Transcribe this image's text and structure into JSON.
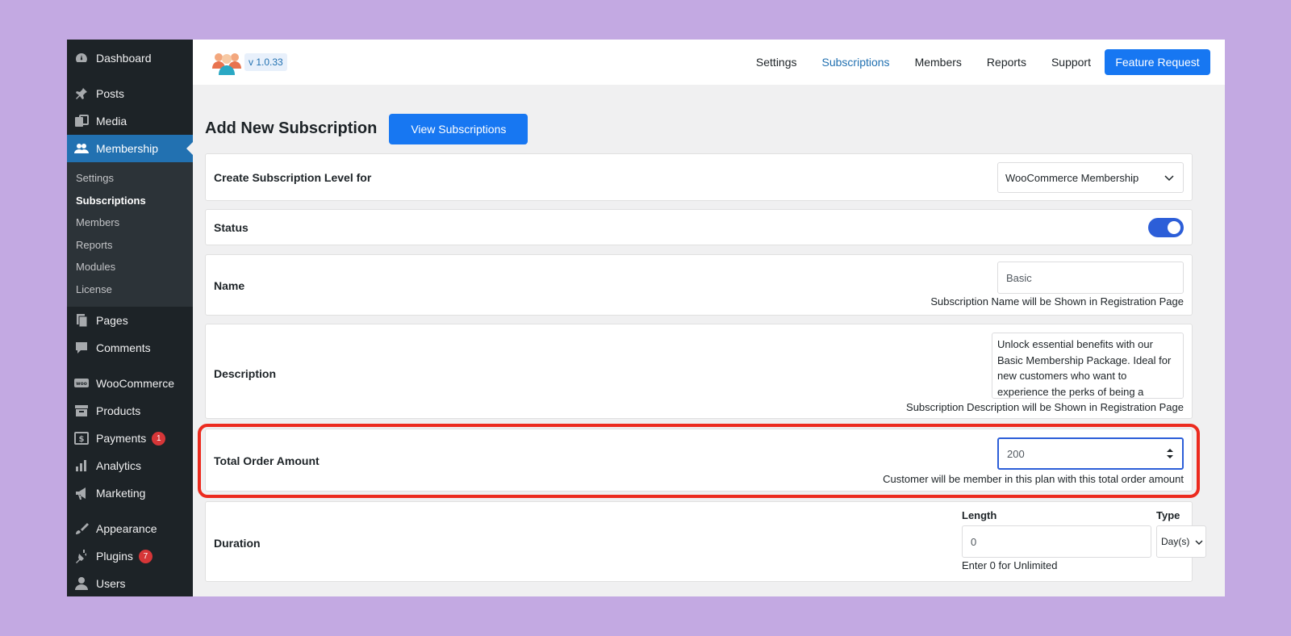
{
  "sidebar": {
    "items": [
      {
        "label": "Dashboard",
        "icon": "dashboard-icon"
      },
      {
        "label": "Posts",
        "icon": "pin-icon"
      },
      {
        "label": "Media",
        "icon": "media-icon"
      },
      {
        "label": "Membership",
        "icon": "users-icon"
      }
    ],
    "submenu": [
      "Settings",
      "Subscriptions",
      "Members",
      "Reports",
      "Modules",
      "License"
    ],
    "items2": [
      {
        "label": "Pages",
        "icon": "pages-icon"
      },
      {
        "label": "Comments",
        "icon": "comment-icon"
      }
    ],
    "items3": [
      {
        "label": "WooCommerce",
        "icon": "woo-icon"
      },
      {
        "label": "Products",
        "icon": "archive-icon"
      },
      {
        "label": "Payments",
        "icon": "payments-icon",
        "badge": "1"
      },
      {
        "label": "Analytics",
        "icon": "bar-chart-icon"
      },
      {
        "label": "Marketing",
        "icon": "megaphone-icon"
      }
    ],
    "items4": [
      {
        "label": "Appearance",
        "icon": "brush-icon"
      },
      {
        "label": "Plugins",
        "icon": "plug-icon",
        "badge": "7"
      },
      {
        "label": "Users",
        "icon": "user-icon"
      }
    ]
  },
  "topbar": {
    "version": "v 1.0.33",
    "nav": [
      "Settings",
      "Subscriptions",
      "Members",
      "Reports",
      "Support"
    ],
    "feature_request": "Feature Request"
  },
  "page": {
    "title": "Add New Subscription",
    "view_button": "View Subscriptions"
  },
  "form": {
    "level_label": "Create Subscription Level for",
    "level_value": "WooCommerce Membership",
    "status_label": "Status",
    "name_label": "Name",
    "name_value": "Basic",
    "name_hint": "Subscription Name will be Shown in Registration Page",
    "description_label": "Description",
    "description_value": "Unlock essential benefits with our Basic Membership Package. Ideal for new customers who want to experience the perks of being a",
    "description_hint": "Subscription Description will be Shown in Registration Page",
    "total_label": "Total Order Amount",
    "total_value": "200",
    "total_hint": "Customer will be member in this plan with this total order amount",
    "duration_label": "Duration",
    "length_label": "Length",
    "length_value": "0",
    "length_hint": "Enter 0 for Unlimited",
    "type_label": "Type",
    "type_value": "Day(s)"
  },
  "colors": {
    "accent": "#1777f2",
    "sidebar_bg": "#1d2327",
    "active_menu": "#2271b1",
    "highlight": "#ec2b1f"
  }
}
